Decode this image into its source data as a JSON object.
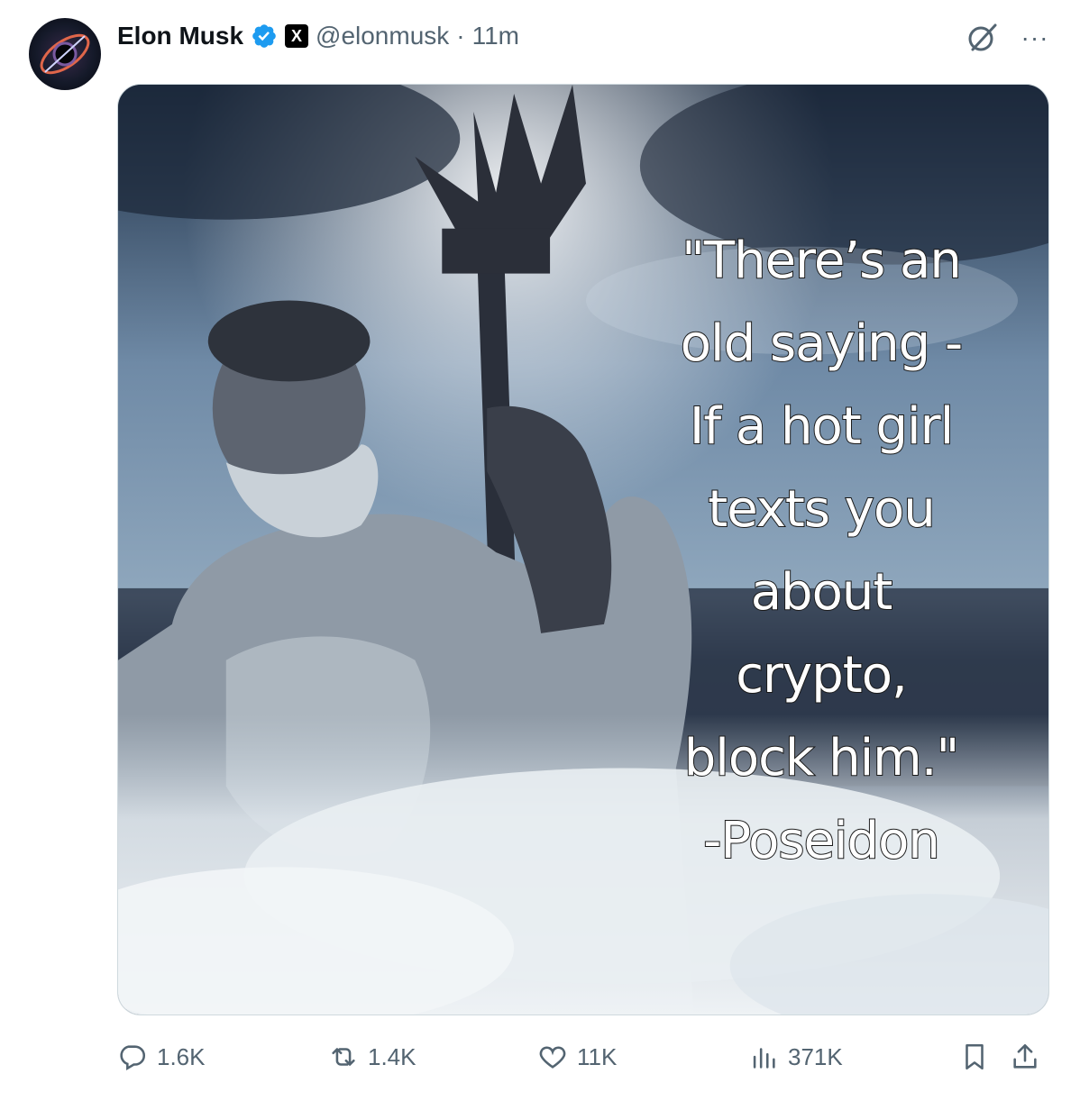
{
  "tweet": {
    "author_name": "Elon Musk",
    "handle": "@elonmusk",
    "separator": "·",
    "time": "11m",
    "badges": {
      "verified": "verified-check-icon",
      "affiliate": "x-logo-icon"
    },
    "affiliate_letter": "X",
    "more_label": "···"
  },
  "media": {
    "quote_lines": [
      "\"There’s an",
      "old saying -",
      "If a hot girl",
      "texts you",
      "about",
      "crypto,",
      "block him.\"",
      "-Poseidon"
    ]
  },
  "stats": {
    "replies": "1.6K",
    "reposts": "1.4K",
    "likes": "11K",
    "views": "371K"
  },
  "colors": {
    "accent_verified": "#1d9bf0",
    "muted_text": "#536471",
    "text": "#0f1419"
  }
}
